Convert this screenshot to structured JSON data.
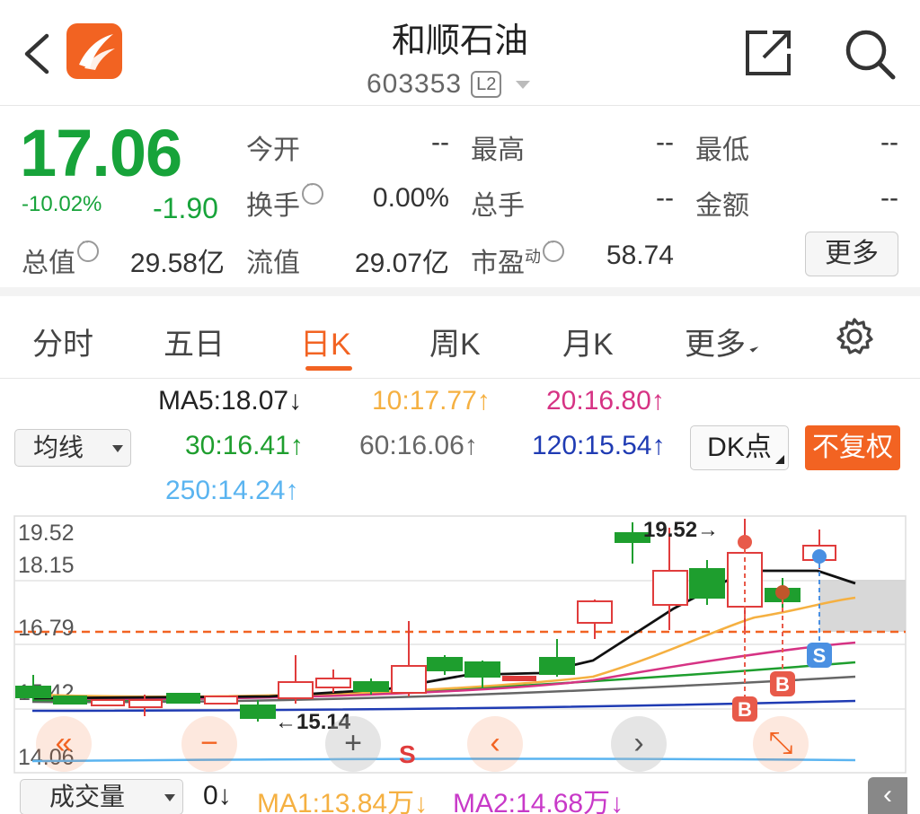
{
  "header": {
    "title": "和顺石油",
    "code": "603353",
    "level_badge": "L2",
    "icons": [
      "back-icon",
      "app-logo-icon",
      "share-icon",
      "search-icon"
    ]
  },
  "quote": {
    "price": "17.06",
    "change_pct": "-10.02%",
    "change": "-1.90",
    "fields": [
      {
        "label": "今开",
        "value": "--"
      },
      {
        "label": "最高",
        "value": "--"
      },
      {
        "label": "最低",
        "value": "--"
      },
      {
        "label": "换手",
        "value": "0.00%"
      },
      {
        "label": "总手",
        "value": "--"
      },
      {
        "label": "金额",
        "value": "--"
      },
      {
        "label": "总值",
        "value": "29.58亿"
      },
      {
        "label": "流值",
        "value": "29.07亿"
      },
      {
        "label": "市盈",
        "sup": "动",
        "value": "58.74"
      }
    ],
    "more_label": "更多",
    "color_down": "#17a33a"
  },
  "tabs": {
    "items": [
      "分时",
      "五日",
      "日K",
      "周K",
      "月K",
      "更多"
    ],
    "active": "日K",
    "accent": "#f26322"
  },
  "ma_legend": {
    "mode_select": "均线",
    "items": [
      {
        "text": "MA5:18.07↓",
        "color": "#222222"
      },
      {
        "text": "10:17.77↑",
        "color": "#f5b041"
      },
      {
        "text": "20:16.80↑",
        "color": "#d63384"
      },
      {
        "text": "30:16.41↑",
        "color": "#1e9e2e"
      },
      {
        "text": "60:16.06↑",
        "color": "#666666"
      },
      {
        "text": "120:15.54↑",
        "color": "#1f3bb3"
      },
      {
        "text": "250:14.24↑",
        "color": "#5ab4f0"
      }
    ],
    "dk_label": "DK点",
    "adjust_label": "不复权"
  },
  "chart": {
    "y_labels": [
      "19.52",
      "18.15",
      "16.79",
      "15.42",
      "14.06"
    ],
    "max_annotation": "19.52→",
    "min_annotation": "←15.14",
    "current_price_line": 16.79,
    "signal_s_label": "S",
    "badge_b": "B",
    "badge_s": "S",
    "controls": [
      {
        "name": "fast-back-button",
        "glyph": "«"
      },
      {
        "name": "zoom-out-button",
        "glyph": "−"
      },
      {
        "name": "zoom-in-button",
        "glyph": "+"
      },
      {
        "name": "prev-button",
        "glyph": "‹"
      },
      {
        "name": "next-button",
        "glyph": "›"
      },
      {
        "name": "fullscreen-button",
        "glyph": "⤡"
      }
    ]
  },
  "volume": {
    "indicator_select": "成交量",
    "current": "0↓",
    "ma1": "MA1:13.84万↓",
    "ma2": "MA2:14.68万↓",
    "ma1_color": "#f5b041",
    "ma2_color": "#c839c8",
    "collapse_glyph": "‹"
  }
}
